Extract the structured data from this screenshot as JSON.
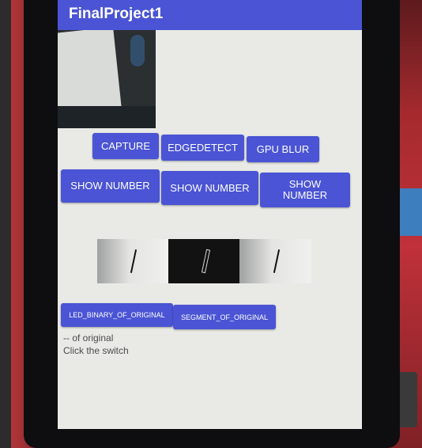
{
  "app": {
    "title": "FinalProject1",
    "accent_color": "#4a54d4"
  },
  "top_buttons": [
    {
      "label": "CAPTURE"
    },
    {
      "label": "EDGEDETECT"
    },
    {
      "label": "GPU BLUR"
    }
  ],
  "number_buttons": [
    {
      "label": "SHOW NUMBER"
    },
    {
      "label": "SHOW NUMBER"
    },
    {
      "label": "SHOW NUMBER"
    }
  ],
  "segment_buttons": [
    {
      "label": "LED_BINARY_OF_ORIGINAL"
    },
    {
      "label": "SEGMENT_OF_ORIGINAL"
    }
  ],
  "info": {
    "line1": "-- of original",
    "line2": "Click the switch"
  }
}
